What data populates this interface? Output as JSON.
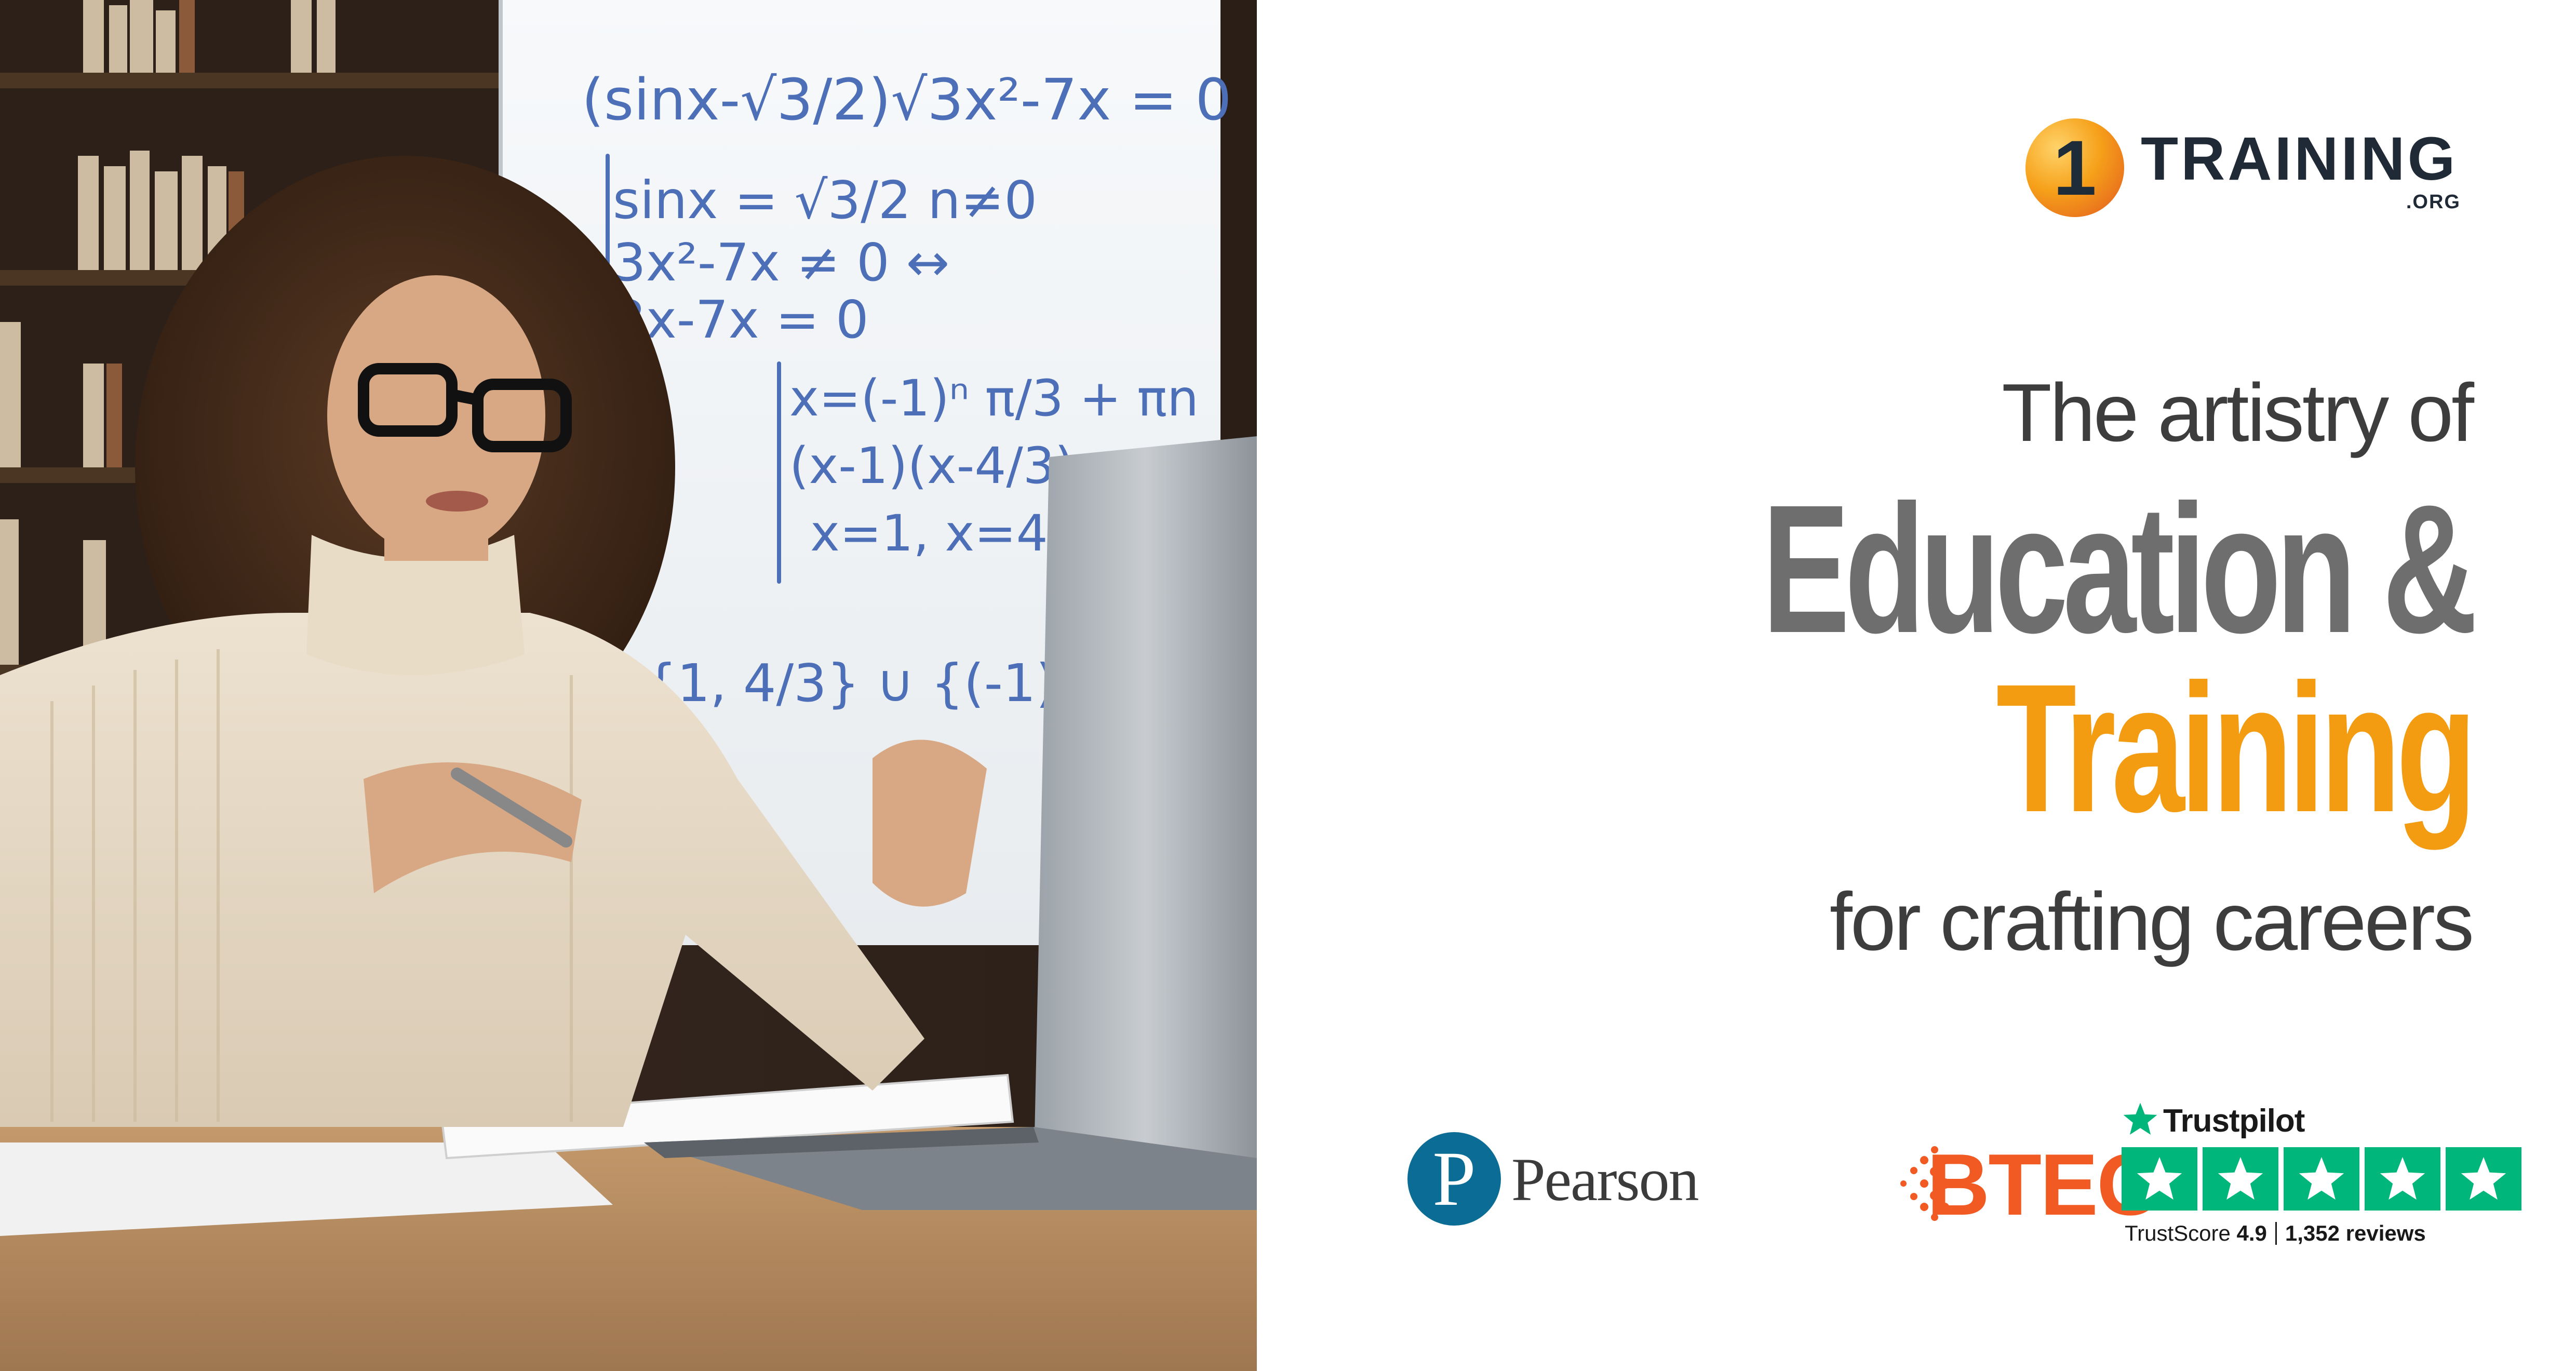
{
  "brand": {
    "logo_digit": "1",
    "name": "TRAINING",
    "tld": ".ORG",
    "colors": {
      "orange": "#f39c12",
      "gray": "#6e6e6e",
      "dark": "#1f2a36"
    }
  },
  "headline": {
    "line1": "The artistry of",
    "line2": "Education &",
    "line3": "Training",
    "line4": "for crafting careers"
  },
  "partners": {
    "pearson": {
      "mark": "P",
      "name": "Pearson",
      "icon": "pearson-logo-icon"
    },
    "btec": {
      "name": "BTEC",
      "color": "#f15a22",
      "icon": "btec-dots-icon"
    }
  },
  "trustpilot": {
    "name": "Trustpilot",
    "score_label": "TrustScore",
    "score": "4.9",
    "reviews": "1,352 reviews",
    "stars": 5,
    "color": "#00b67a"
  },
  "photo": {
    "board_lines": [
      "(sinx-√3/2)√3x²-7x = 0",
      "sinx = √3/2   n≠0",
      "3x²-7x ≠ 0  ↔",
      "3x-7x = 0",
      "x=(-1)ⁿ π/3 + πn",
      "(x-1)(x-4/3)",
      "x=1, x=4/3",
      "{1, 4/3} ∪ {(-1)ⁿ π/3"
    ]
  }
}
